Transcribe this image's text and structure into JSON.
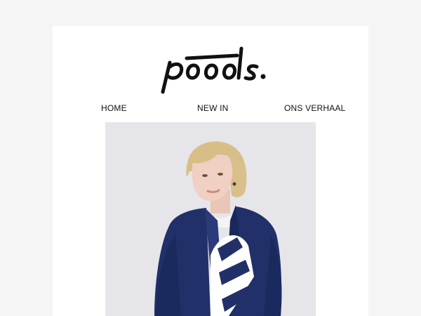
{
  "brand": {
    "logo_text": "pooools.",
    "logo_icon": "brand-wordmark"
  },
  "nav": {
    "items": [
      {
        "label": "HOME"
      },
      {
        "label": "NEW IN"
      },
      {
        "label": "ONS VERHAAL"
      }
    ]
  },
  "hero": {
    "image_icon": "hero-photo",
    "background_color": "#e6e5ea"
  },
  "colors": {
    "page_background": "#f5f5f5",
    "card_background": "#ffffff",
    "text": "#111111",
    "jacket_navy": "#1f2f66"
  }
}
